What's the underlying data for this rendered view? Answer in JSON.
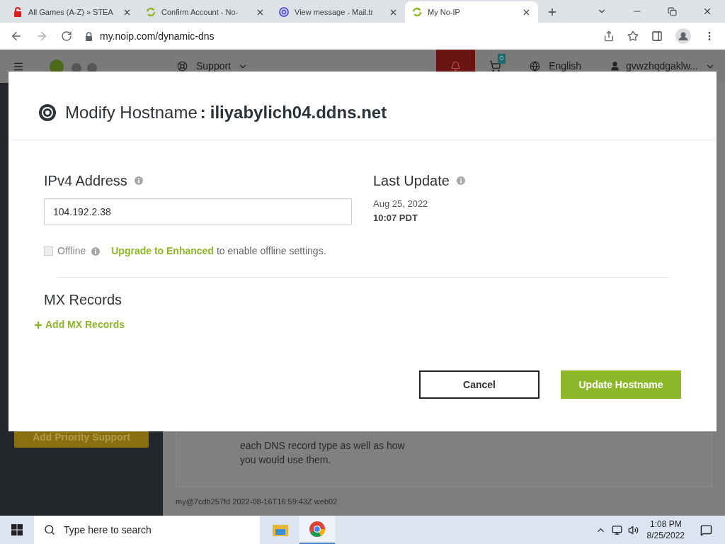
{
  "browser": {
    "tabs": [
      {
        "title": "All Games (A-Z) » STEA",
        "kind": "lock",
        "selected": false
      },
      {
        "title": "Confirm Account - No-",
        "kind": "noip",
        "selected": false
      },
      {
        "title": "View message - Mail.tr",
        "kind": "mail",
        "selected": false
      },
      {
        "title": "My No-IP",
        "kind": "noip",
        "selected": true
      }
    ],
    "url": "my.noip.com/dynamic-dns"
  },
  "site": {
    "header": {
      "support": "Support",
      "cart_count": "0",
      "language": "English",
      "user": "gvwzhqdgaklw..."
    },
    "sidebar_button": "Add Priority Support",
    "card_text": [
      "each DNS record type as well as how",
      "you would use them."
    ],
    "footer": "my@7cdb257fd 2022-08-16T16:59:43Z web02"
  },
  "modal": {
    "title": "Modify Hostname",
    "separator": ":",
    "hostname": "iliyabylich04.ddns.net",
    "ipv4_label": "IPv4 Address",
    "ipv4_value": "104.192.2.38",
    "last_update_label": "Last Update",
    "last_update_date": "Aug 25, 2022",
    "last_update_time": "10:07 PDT",
    "offline": {
      "label": "Offline",
      "checked": false,
      "disabled": true
    },
    "upgrade_link": "Upgrade to Enhanced",
    "upgrade_text": "to enable offline settings.",
    "mx_title": "MX Records",
    "add_mx": "Add MX Records",
    "buttons": [
      {
        "label": "Cancel",
        "kind": "secondary"
      },
      {
        "label": "Update Hostname",
        "kind": "primary"
      }
    ]
  },
  "taskbar": {
    "search_placeholder": "Type here to search",
    "time": "1:08 PM",
    "date": "8/25/2022"
  }
}
